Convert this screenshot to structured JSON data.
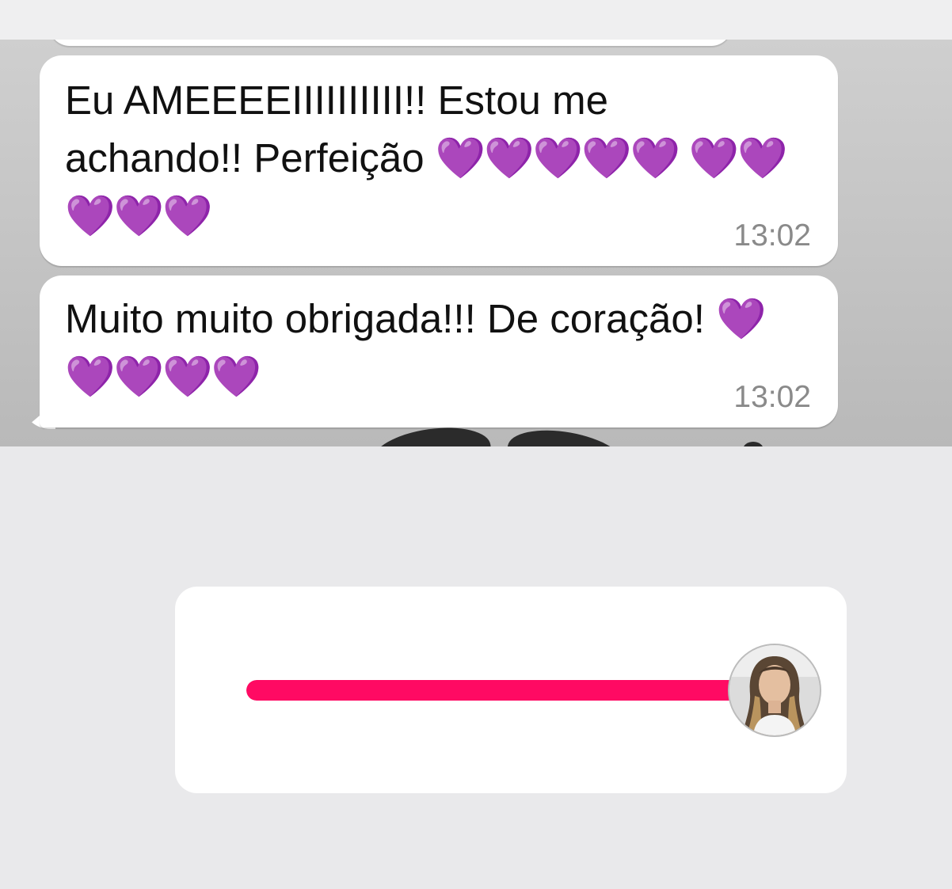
{
  "messages": [
    {
      "text": "Eu AMEEEEIIIIIIIIII!! Estou me achando!! Perfeição",
      "hearts": "💜💜💜💜💜 💜💜💜💜💜",
      "time": "13:02"
    },
    {
      "text": "Muito muito obrigada!!! De coração!",
      "hearts": "💜💜💜💜💜",
      "time": "13:02"
    }
  ],
  "colors": {
    "slider_fill": "#ff0a63",
    "heart": "#a63ff0"
  },
  "slider": {
    "value_percent": 100,
    "thumb_icon": "avatar-photo"
  }
}
